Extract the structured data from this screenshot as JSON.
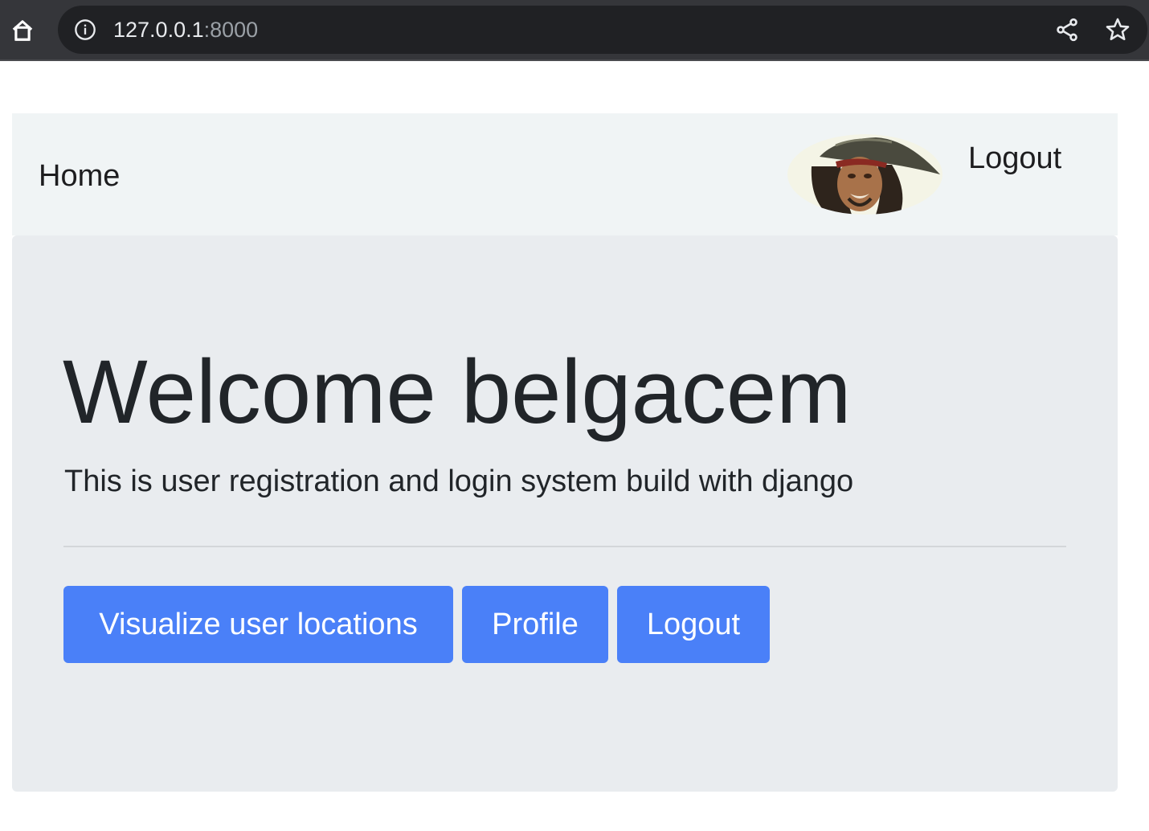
{
  "browser": {
    "url_host": "127.0.0.1",
    "url_port": ":8000",
    "icons": [
      "home-icon",
      "info-icon",
      "share-icon",
      "star-icon"
    ]
  },
  "navbar": {
    "home_label": "Home",
    "logout_label": "Logout",
    "avatar": "user-avatar-image"
  },
  "jumbotron": {
    "title": "Welcome belgacem",
    "lead": "This is user registration and login system build with django",
    "buttons": [
      {
        "label": "Visualize user locations"
      },
      {
        "label": "Profile"
      },
      {
        "label": "Logout"
      }
    ]
  },
  "colors": {
    "browser_bg": "#35363a",
    "omnibox_bg": "#202124",
    "navbar_bg": "#f0f4f5",
    "jumbotron_bg": "#e9ecef",
    "button_primary": "#4a80f8"
  }
}
